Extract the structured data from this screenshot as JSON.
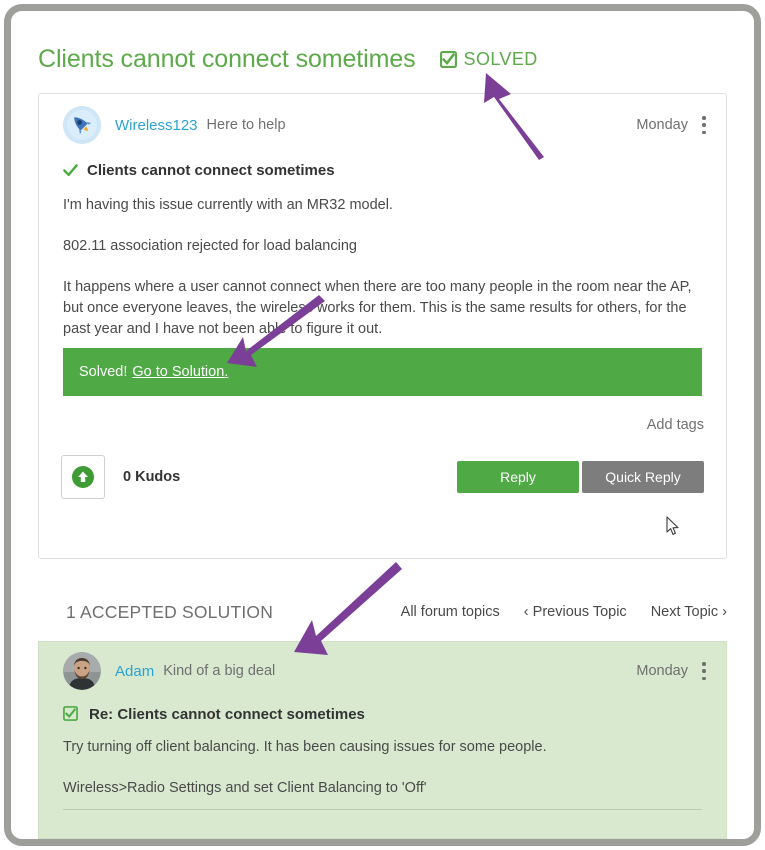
{
  "header": {
    "title": "Clients cannot connect sometimes",
    "status_label": "SOLVED",
    "status_icon": "checked-box-icon",
    "status_color": "#5caa4a"
  },
  "post": {
    "avatar_icon": "rocket-avatar-icon",
    "author": "Wireless123",
    "rank": "Here to help",
    "timestamp": "Monday",
    "menu_icon": "kebab-menu-icon",
    "subject_icon": "green-check-icon",
    "subject": "Clients cannot connect sometimes",
    "paragraphs": [
      "I'm having this issue currently with an MR32 model.",
      "802.11 association rejected for load balancing",
      "It happens where a user cannot connect when there are too many people in the room near the AP, but once everyone leaves, the wireless works for them.  This is the same results for others, for the past year and I have not been able to figure it out."
    ],
    "solved_banner": {
      "text": "Solved!",
      "link": "Go to Solution.",
      "background": "#4faa45"
    },
    "add_tags": "Add tags",
    "kudos_icon": "kudos-up-arrow-icon",
    "kudos_count": "0 Kudos",
    "reply_button": "Reply",
    "quick_reply_button": "Quick Reply"
  },
  "solutions_nav": {
    "heading": "1 ACCEPTED SOLUTION",
    "all_topics": "All forum topics",
    "previous_topic": "Previous Topic",
    "next_topic": "Next Topic",
    "prev_chevron": "‹",
    "next_chevron": "›"
  },
  "solution": {
    "avatar_icon": "user-photo-avatar",
    "author": "Adam",
    "rank": "Kind of a big deal",
    "timestamp": "Monday",
    "menu_icon": "kebab-menu-icon",
    "subject_icon": "accepted-solution-check-icon",
    "subject": "Re: Clients cannot connect sometimes",
    "paragraphs": [
      "Try turning off client balancing.  It has been causing issues for some people.",
      "Wireless>Radio Settings and set Client Balancing to 'Off'"
    ],
    "background": "#d8e9d0"
  },
  "annotations": {
    "color": "#7b3f98",
    "arrows": [
      "arrow-to-solved-badge",
      "arrow-to-post-body",
      "arrow-to-accepted-solution"
    ]
  }
}
